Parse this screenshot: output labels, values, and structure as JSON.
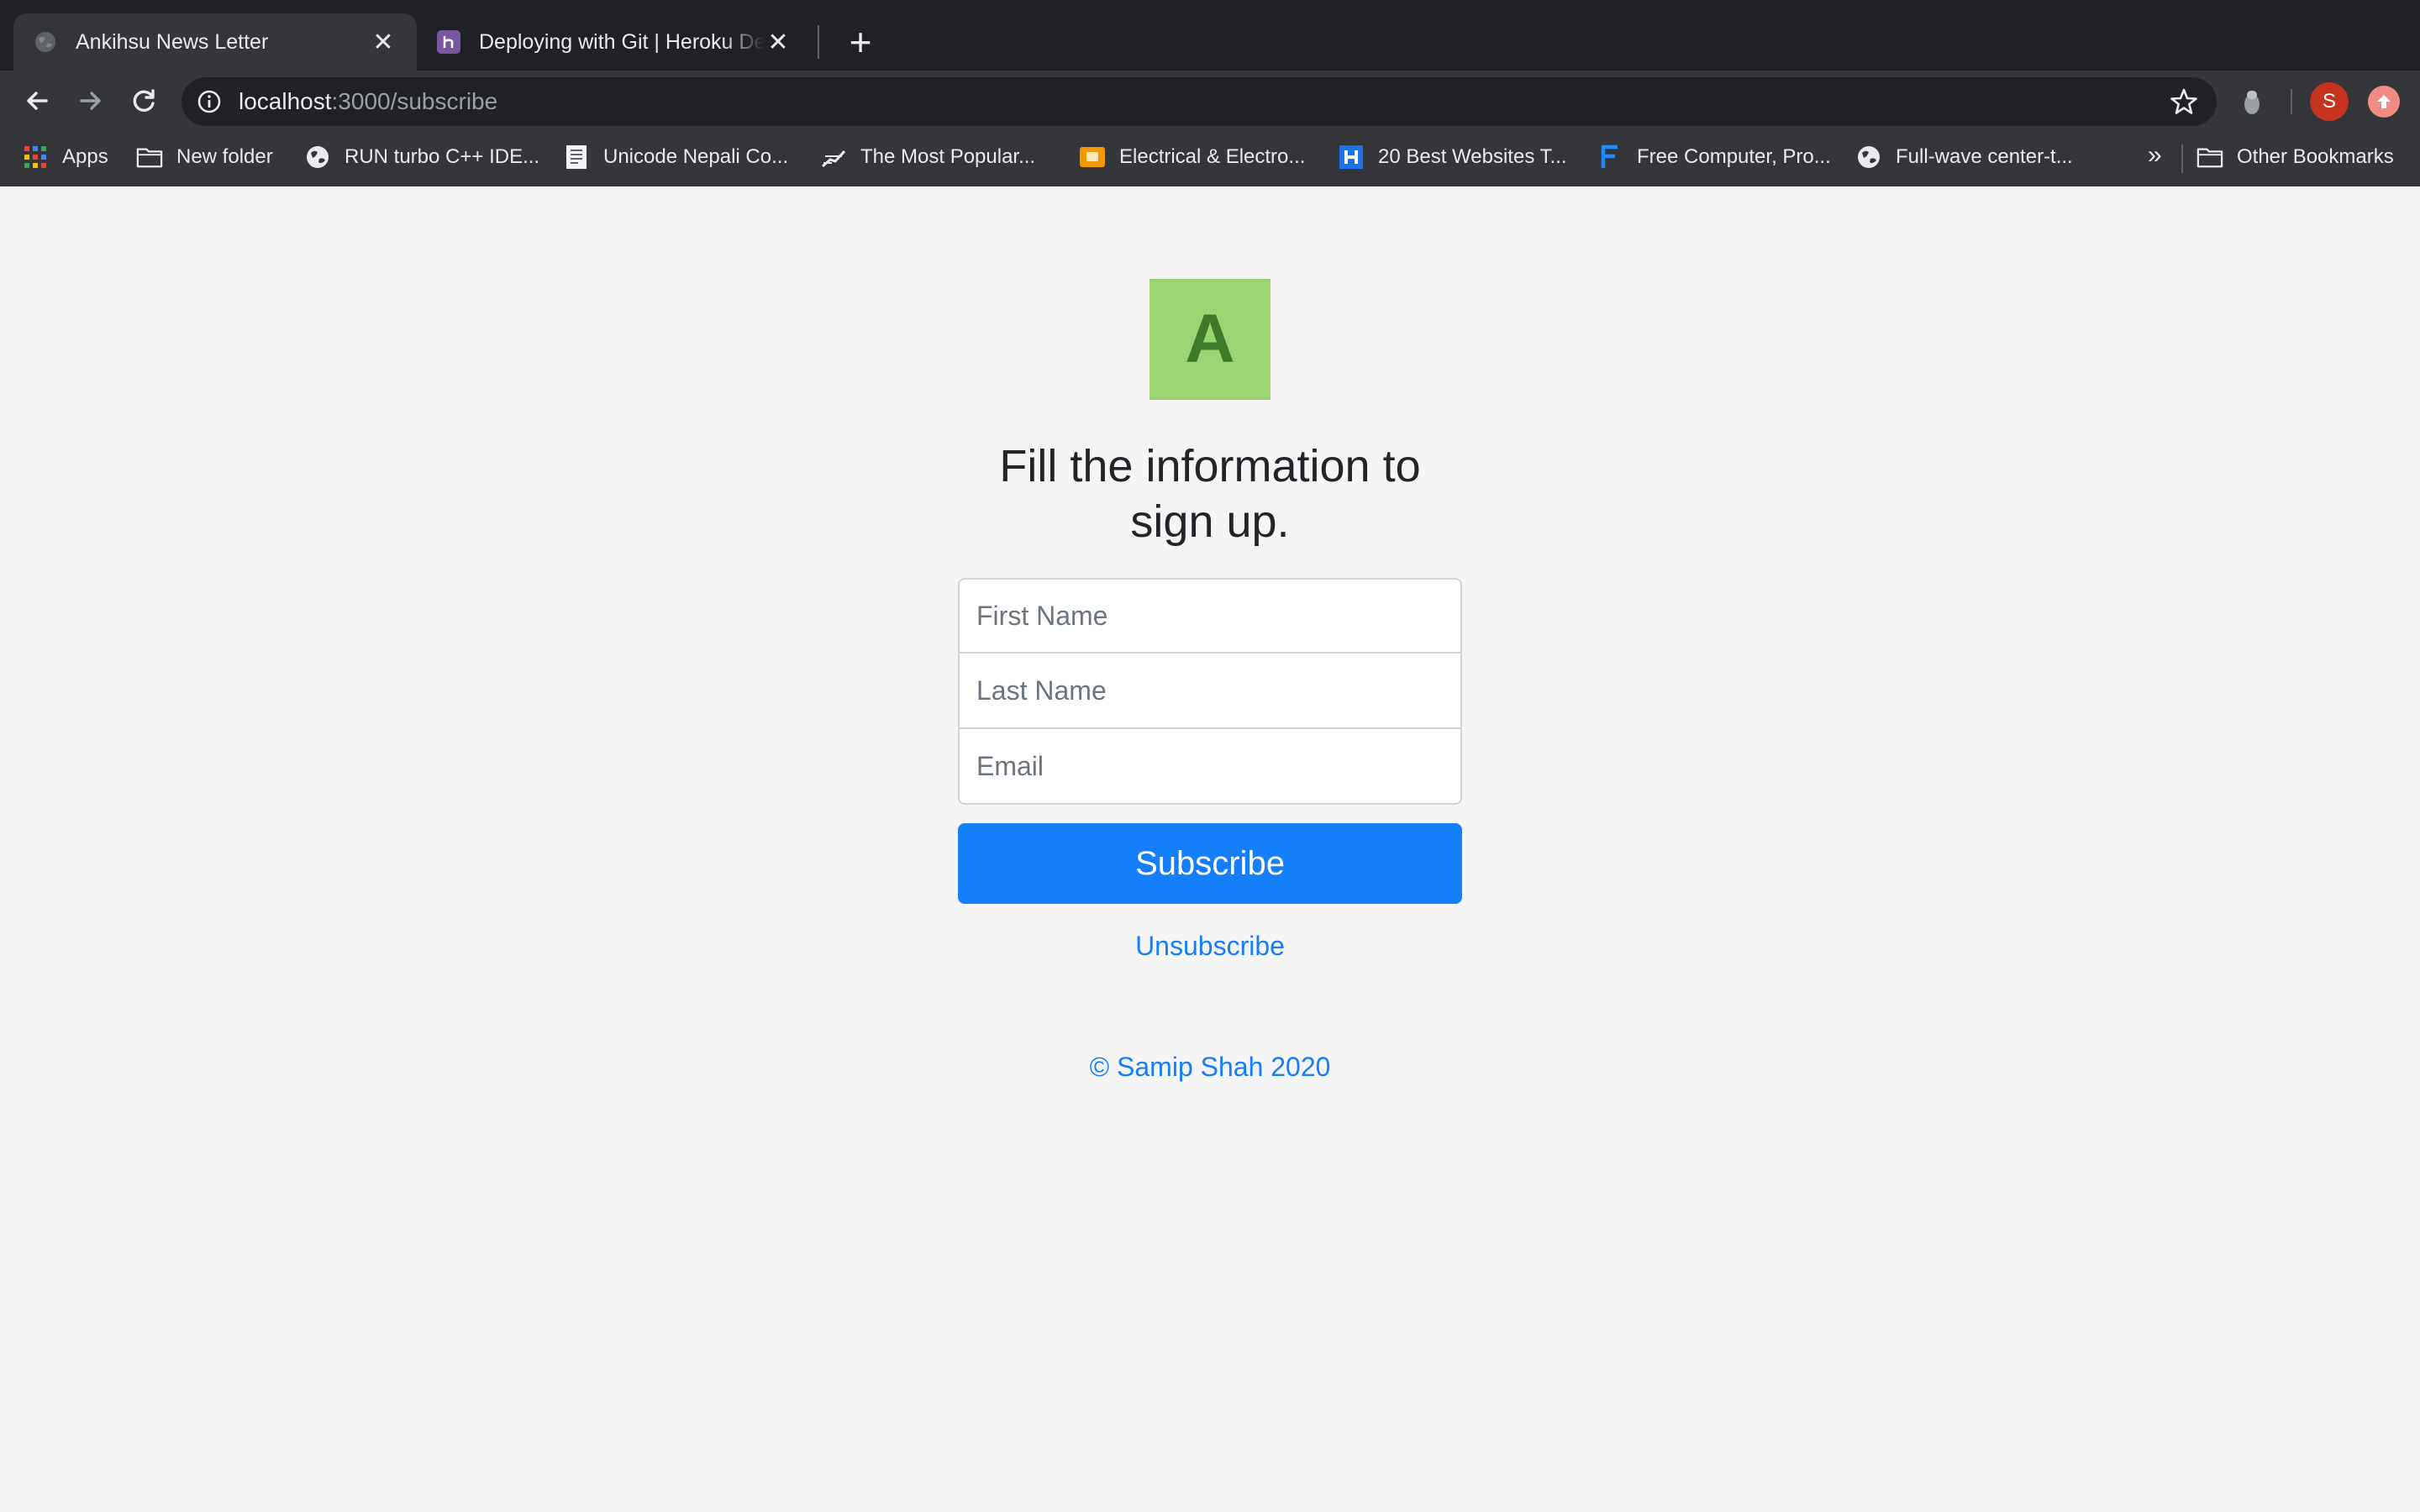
{
  "browser": {
    "tabs": [
      {
        "title": "Ankihsu News Letter",
        "active": true,
        "icon": "globe-icon"
      },
      {
        "title": "Deploying with Git | Heroku Dev Center",
        "active": false,
        "icon": "heroku-icon"
      }
    ],
    "new_tab_label": "+",
    "close_glyph": "✕",
    "url": {
      "host": "localhost",
      "rest": ":3000/subscribe"
    },
    "profile_initial": "S",
    "bookmarks": [
      {
        "label": "Apps",
        "icon": "apps-grid-icon"
      },
      {
        "label": "New folder",
        "icon": "folder-icon"
      },
      {
        "label": "RUN turbo C++ IDE...",
        "icon": "globe-icon"
      },
      {
        "label": "Unicode Nepali Co...",
        "icon": "document-icon"
      },
      {
        "label": "The Most Popular...",
        "icon": "site-icon"
      },
      {
        "label": "Electrical & Electro...",
        "icon": "slides-icon"
      },
      {
        "label": "20 Best Websites T...",
        "icon": "h-icon"
      },
      {
        "label": "Free Computer, Pro...",
        "icon": "f-icon"
      },
      {
        "label": "Full-wave center-t...",
        "icon": "globe-icon"
      }
    ],
    "bookmarks_more": "»",
    "other_bookmarks": "Other Bookmarks"
  },
  "page": {
    "logo_letter": "A",
    "heading": "Fill the information to sign up.",
    "form": {
      "first_name_placeholder": "First Name",
      "last_name_placeholder": "Last Name",
      "email_placeholder": "Email",
      "submit_label": "Subscribe"
    },
    "unsubscribe_label": "Unsubscribe",
    "footer": "© Samip Shah 2020"
  },
  "colors": {
    "primary": "#157efb",
    "logo_bg": "#9bd573",
    "logo_fg": "#3b7a26",
    "page_bg": "#f5f5f5",
    "chrome_dark": "#202124",
    "chrome_mid": "#35363a"
  }
}
